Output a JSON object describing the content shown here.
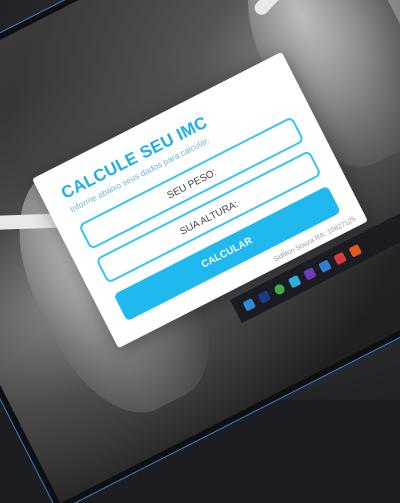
{
  "form": {
    "title": "CALCULE SEU IMC",
    "subtitle": "Informe abaixo seus dados para calcular.",
    "weight_placeholder": "SEU PESO:",
    "height_placeholder": "SUA ALTURA:",
    "calculate_label": "CALCULAR"
  },
  "footer": {
    "credit": "Sidilton Souza RA: 10827125"
  },
  "colors": {
    "accent": "#1fb9f0",
    "field_border": "#34c6f0",
    "taskbar": "#1a1c22"
  },
  "taskbar": {
    "icons": [
      {
        "name": "vscode-icon",
        "color": "#2f8bd8"
      },
      {
        "name": "photoshop-icon",
        "color": "#1a3a8a"
      },
      {
        "name": "chrome-icon",
        "color": "#3fae4b"
      },
      {
        "name": "edge-icon",
        "color": "#2ab0d9"
      },
      {
        "name": "visual-studio-icon",
        "color": "#6b3db8"
      },
      {
        "name": "store-icon",
        "color": "#2d7fd0"
      },
      {
        "name": "app-icon",
        "color": "#d83b3b"
      },
      {
        "name": "office-icon",
        "color": "#e05a1f"
      }
    ]
  }
}
